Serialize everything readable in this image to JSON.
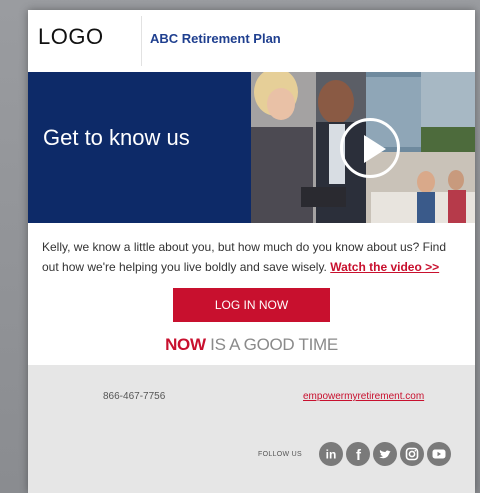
{
  "header": {
    "logo": "LOGO",
    "plan_name": "ABC Retirement Plan"
  },
  "hero": {
    "title": "Get to know us",
    "play_icon": "play-icon"
  },
  "body": {
    "message": "Kelly, we know a little about you, but how much do you know about us? Find out how we're helping you live boldly and save wisely.",
    "video_link": "Watch the video >>"
  },
  "cta": {
    "login_label": "LOG IN NOW"
  },
  "tagline": {
    "highlight": "NOW",
    "rest": "IS A GOOD TIME"
  },
  "footer": {
    "phone": "866-467-7756",
    "website": "empowermyretirement.com",
    "follow_label": "FOLLOW US",
    "social": [
      "linkedin-icon",
      "facebook-icon",
      "twitter-icon",
      "instagram-icon",
      "youtube-icon"
    ]
  },
  "colors": {
    "navy": "#0d2a68",
    "red": "#c8102e",
    "footer_bg": "#e6e6e6",
    "plan_blue": "#1f3f8f"
  }
}
